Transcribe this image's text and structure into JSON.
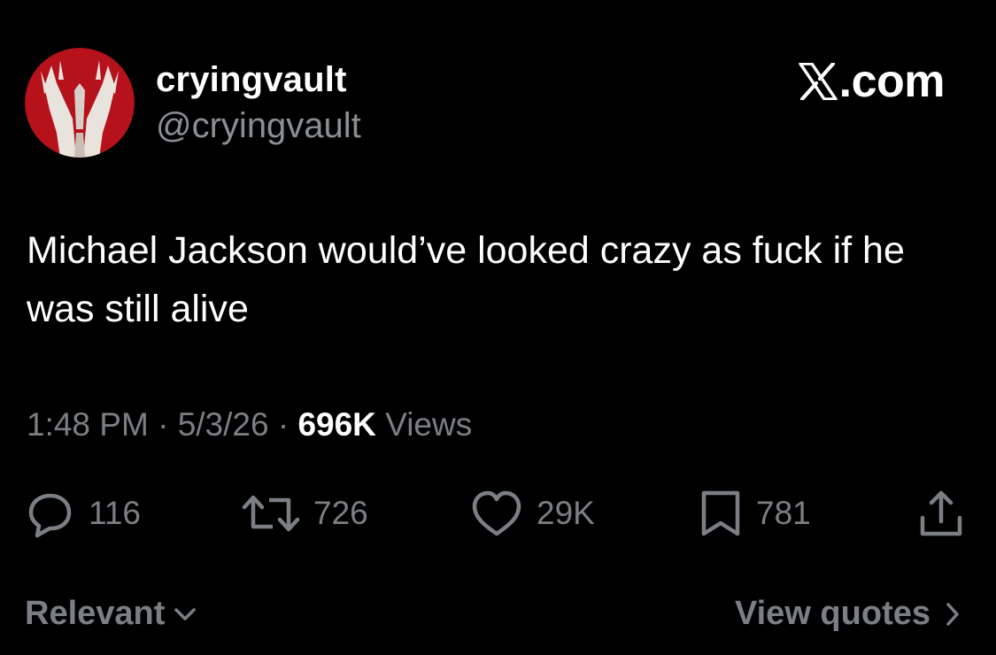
{
  "author": {
    "display_name": "cryingvault",
    "handle": "@cryingvault",
    "avatar_icon": "praying-hands-avatar"
  },
  "brand": {
    "text": ".com",
    "icon": "x-logo-icon"
  },
  "tweet": {
    "text": "Michael Jackson would’ve looked crazy as fuck if he was still alive"
  },
  "meta": {
    "time": "1:48 PM",
    "separator": "·",
    "date": "5/3/26",
    "views_count": "696K",
    "views_label": "Views"
  },
  "actions": {
    "replies": "116",
    "reposts": "726",
    "likes": "29K",
    "bookmarks": "781"
  },
  "footer": {
    "sort_label": "Relevant",
    "view_quotes_label": "View quotes"
  },
  "colors": {
    "background": "#000000",
    "primary_text": "#ffffff",
    "secondary_text": "#7b7f84",
    "avatar_bg": "#b5121b"
  }
}
